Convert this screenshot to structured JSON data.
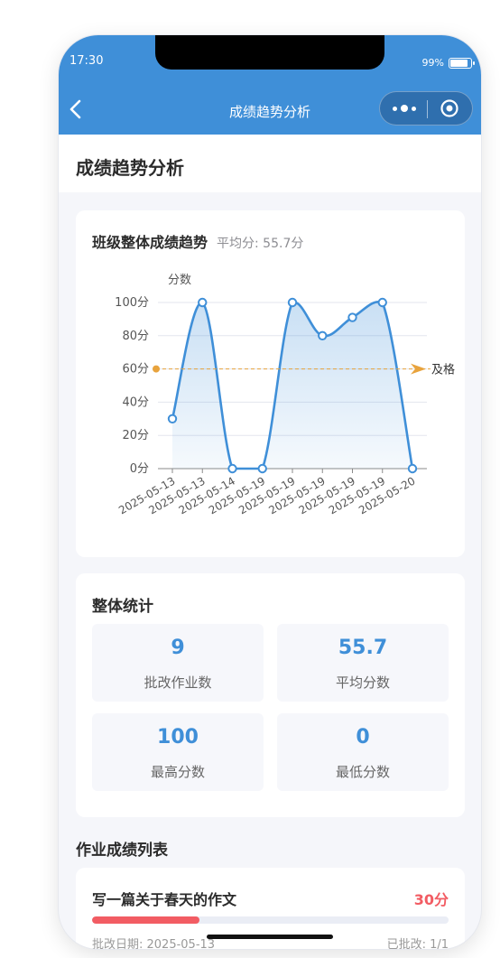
{
  "status_bar": {
    "time": "17:30",
    "battery": "99%"
  },
  "navbar": {
    "title": "成绩趋势分析"
  },
  "page": {
    "title": "成绩趋势分析"
  },
  "chart_card": {
    "title": "班级整体成绩趋势",
    "average_label": "平均分: 55.7分"
  },
  "chart_data": {
    "type": "line",
    "ylabel": "分数",
    "ylim": [
      0,
      100
    ],
    "y_ticks": [
      "0分",
      "20分",
      "40分",
      "60分",
      "80分",
      "100分"
    ],
    "categories": [
      "2025-05-13",
      "2025-05-13",
      "2025-05-14",
      "2025-05-19",
      "2025-05-19",
      "2025-05-19",
      "2025-05-19",
      "2025-05-19",
      "2025-05-20"
    ],
    "series": [
      {
        "values": [
          30,
          100,
          0,
          0,
          100,
          80,
          91,
          100,
          0
        ]
      }
    ],
    "reference_line": {
      "value": 60,
      "label": "及格"
    },
    "grid": true,
    "smooth": true,
    "area_fill": true,
    "colors": {
      "line": "#3f8fd8",
      "reference": "#e8a33d"
    }
  },
  "stats": {
    "title": "整体统计",
    "items": [
      {
        "value": "9",
        "label": "批改作业数"
      },
      {
        "value": "55.7",
        "label": "平均分数"
      },
      {
        "value": "100",
        "label": "最高分数"
      },
      {
        "value": "0",
        "label": "最低分数"
      }
    ]
  },
  "list": {
    "title": "作业成绩列表",
    "items": [
      {
        "name": "写一篇关于春天的作文",
        "score": "30分",
        "score_value": 30,
        "date": "批改日期: 2025-05-13",
        "status": "已批改: 1/1"
      }
    ]
  },
  "colors": {
    "primary": "#3f8fd8",
    "danger": "#f25c63",
    "background": "#f5f6fa"
  }
}
